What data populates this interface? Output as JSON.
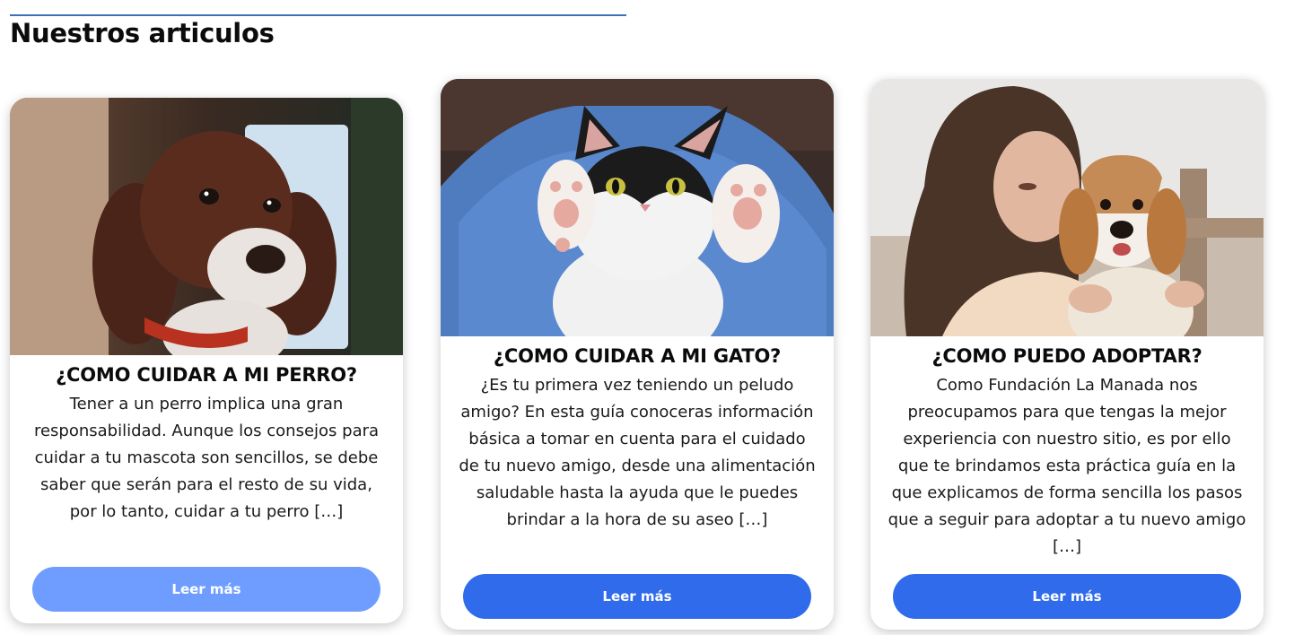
{
  "section": {
    "title": "Nuestros articulos"
  },
  "cards": [
    {
      "title": "¿COMO CUIDAR A MI PERRO?",
      "text": "Tener a un perro implica una gran responsabilidad. Aunque los consejos para cuidar a tu mascota son sencillos, se debe saber que serán para el resto de su vida, por lo tanto, cuidar a tu perro […]",
      "button": "Leer más",
      "image_subject": "puppy-photo"
    },
    {
      "title": "¿COMO CUIDAR A MI GATO?",
      "text": "¿Es tu primera vez teniendo un peludo amigo? En esta guía conoceras información básica a tomar en cuenta para el cuidado de tu nuevo amigo, desde una alimentación saludable hasta la ayuda que le puedes brindar a la hora de su aseo […]",
      "button": "Leer más",
      "image_subject": "kitten-photo"
    },
    {
      "title": "¿COMO PUEDO ADOPTAR?",
      "text": "Como Fundación La Manada nos preocupamos para que tengas la mejor experiencia con nuestro sitio, es por ello que te brindamos esta práctica guía en la que explicamos de forma sencilla los pasos que a seguir para adoptar a tu nuevo amigo […]",
      "button": "Leer más",
      "image_subject": "woman-with-beagle-photo"
    }
  ],
  "colors": {
    "accent_rule": "#3f6fb6",
    "button_hover": "#6f9dff",
    "button": "#2f6bea"
  }
}
